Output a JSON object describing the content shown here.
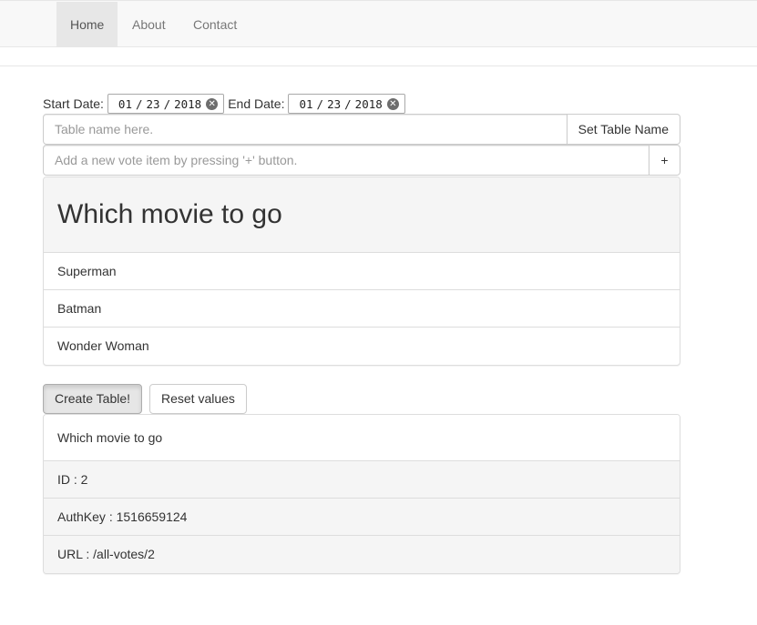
{
  "nav": {
    "items": [
      {
        "label": "Home",
        "active": true
      },
      {
        "label": "About",
        "active": false
      },
      {
        "label": "Contact",
        "active": false
      }
    ]
  },
  "dates": {
    "start_label": "Start Date:",
    "start": {
      "month": "01",
      "day": "23",
      "year": "2018"
    },
    "end_label": "End Date:",
    "end": {
      "month": "01",
      "day": "23",
      "year": "2018"
    },
    "separator": "/"
  },
  "table_name": {
    "placeholder": "Table name here.",
    "button_label": "Set Table Name"
  },
  "vote_item": {
    "placeholder": "Add a new vote item by pressing '+' button.",
    "button_label": "+"
  },
  "vote_panel": {
    "title": "Which movie to go",
    "items": [
      "Superman",
      "Batman",
      "Wonder Woman"
    ]
  },
  "actions": {
    "create_label": "Create Table!",
    "reset_label": "Reset values"
  },
  "result_panel": {
    "title": "Which movie to go",
    "id_text": "ID : 2",
    "authkey_text": "AuthKey : 1516659124",
    "url_text": "URL : /all-votes/2"
  },
  "icons": {
    "clear": "clear-circle-icon"
  }
}
